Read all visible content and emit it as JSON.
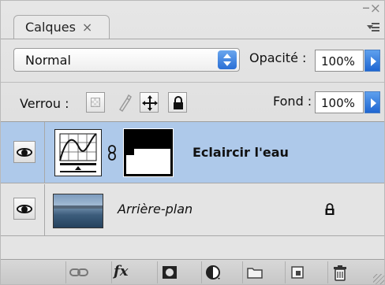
{
  "window": {
    "close_glyph": "×",
    "minimize_glyph": "–"
  },
  "tab": {
    "label": "Calques",
    "close_glyph": "×"
  },
  "blend": {
    "value": "Normal"
  },
  "opacity": {
    "label": "Opacité :",
    "value": "100%"
  },
  "lock": {
    "label": "Verrou :",
    "icons": [
      "lock-transparent-pixels-icon",
      "lock-image-pixels-icon",
      "lock-position-icon",
      "lock-all-icon"
    ]
  },
  "fill": {
    "label": "Fond :",
    "value": "100%"
  },
  "layers": [
    {
      "name": "Eclaircir l'eau",
      "type": "adjustment-curves",
      "selected": true,
      "visible": true
    },
    {
      "name": "Arrière-plan",
      "type": "background",
      "selected": false,
      "visible": true,
      "locked": true
    }
  ],
  "toolbar": {
    "fx_label": "fx",
    "icons": [
      "link-layers-icon",
      "fx-icon",
      "add-mask-icon",
      "adjustment-layer-icon",
      "group-folder-icon",
      "new-layer-icon",
      "trash-icon"
    ]
  },
  "colors": {
    "selected_row": "#aec9ea",
    "accent_blue": "#2a6fd6"
  }
}
